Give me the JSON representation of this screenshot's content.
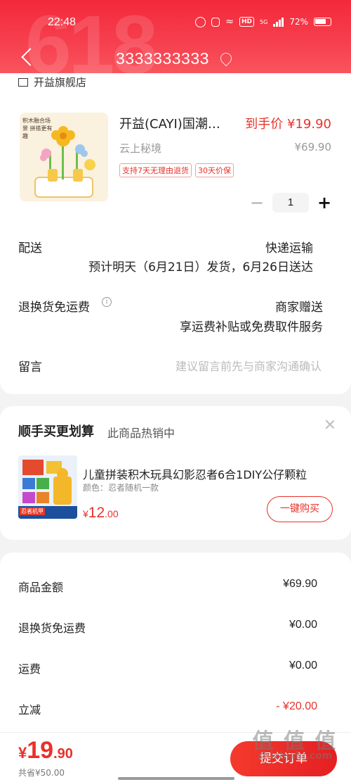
{
  "status_bar": {
    "time": "22:48",
    "battery": "72%",
    "network": "5G",
    "hd": "HD"
  },
  "header": {
    "bg_text": "618",
    "phone": "3333333333"
  },
  "shop": {
    "name_partial": "开益旗舰店"
  },
  "product": {
    "image_text": "积木融合场景 拼搭更有趣",
    "title": "开益(CAYI)国潮积木花束",
    "final_price": "到手价 ¥19.90",
    "shop_name": "云上秘境",
    "original_price": "¥69.90",
    "tags": [
      "支持7天无理由退货",
      "30天价保"
    ],
    "quantity": "1",
    "minus": "−",
    "plus": "+"
  },
  "delivery": {
    "label": "配送",
    "method": "快递运输",
    "estimate": "预计明天（6月21日）发货，6月26日送达"
  },
  "return_shipping": {
    "label": "退换货免运费",
    "info": "i",
    "value": "商家赠送",
    "desc": "享运费补贴或免费取件服务"
  },
  "message": {
    "label": "留言",
    "placeholder": "建议留言前先与商家沟通确认"
  },
  "recommend": {
    "title": "顺手买更划算",
    "subtitle": "此商品热销中",
    "item_name": "儿童拼装积木玩具幻影忍者6合1DIY公仔颗粒",
    "item_spec": "颜色：忍者随机一款",
    "price_currency": "¥",
    "price_int": "12",
    "price_dec": ".00",
    "buy_label": "一键购买",
    "image_text": "忍者机甲"
  },
  "summary": [
    {
      "label": "商品金额",
      "value": "¥69.90"
    },
    {
      "label": "退换货免运费",
      "value": "¥0.00"
    },
    {
      "label": "运费",
      "value": "¥0.00"
    },
    {
      "label": "立减",
      "value": "- ¥20.00"
    }
  ],
  "bottom": {
    "currency": "¥",
    "total_int": "19",
    "total_dec": ".90",
    "saved": "共省¥50.00",
    "submit": "提交订单"
  },
  "watermark": {
    "main": "值 值 值",
    "sub": "zhizhizhi.com"
  },
  "colors": {
    "accent": "#e8322a",
    "header": "#f3283a"
  }
}
